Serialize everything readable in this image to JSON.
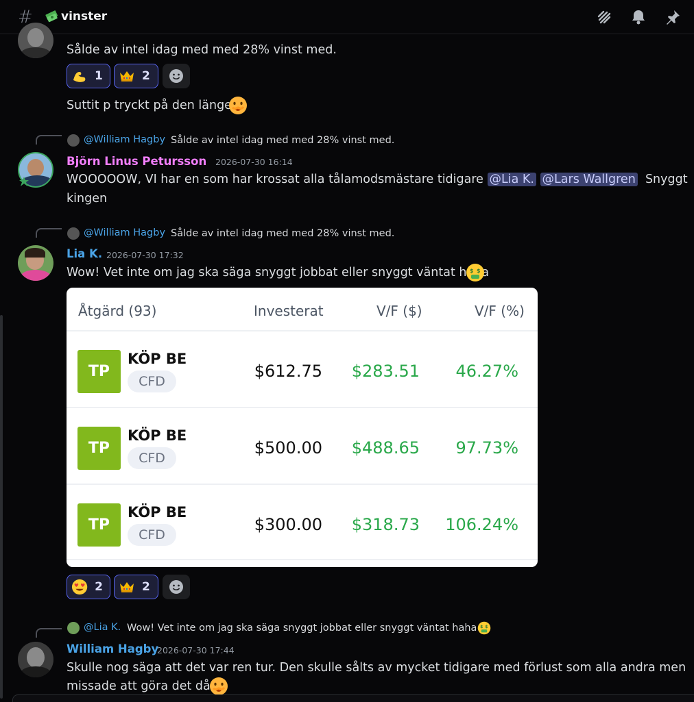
{
  "channel": {
    "name": "vinster",
    "emoji": "money-with-wings"
  },
  "header_icons": [
    "threads-icon",
    "bell-icon",
    "pin-icon"
  ],
  "messages": [
    {
      "text_1": "Sålde av intel idag med med 28% vinst med.",
      "reactions": [
        {
          "emoji": "flexed-biceps",
          "count": "1"
        },
        {
          "emoji": "crown",
          "count": "2"
        }
      ],
      "text_2": "Suttit p tryckt på den länge"
    },
    {
      "reply": {
        "name": "@William Hagby",
        "text": "Sålde av intel idag med med 28% vinst med."
      },
      "author": "Björn Linus Petursson",
      "author_color": "#f47fff",
      "time": "2026-07-30 16:14",
      "text_a": "WOOOOOW, VI har en som har krossat alla tålamodsmästare tidigare",
      "mention_1": "@Lia K.",
      "mention_2": "@Lars Wallgren",
      "text_b": "Snyggt",
      "text_c": "kingen"
    },
    {
      "reply": {
        "name": "@William Hagby",
        "text": "Sålde av intel idag med med 28% vinst med."
      },
      "author": "Lia K.",
      "author_color": "#4aa3e6",
      "time": "2026-07-30 17:32",
      "text": "Wow! Vet inte om jag ska säga snyggt jobbat eller snyggt väntat haha",
      "table": {
        "headers": [
          "Åtgärd (93)",
          "Investerat",
          "V/F ($)",
          "V/F (%)"
        ],
        "rows": [
          {
            "badge": "TP",
            "action": "KÖP BE",
            "type": "CFD",
            "invested": "$612.75",
            "pl": "$283.51",
            "pct": "46.27%"
          },
          {
            "badge": "TP",
            "action": "KÖP BE",
            "type": "CFD",
            "invested": "$500.00",
            "pl": "$488.65",
            "pct": "97.73%"
          },
          {
            "badge": "TP",
            "action": "KÖP BE",
            "type": "CFD",
            "invested": "$300.00",
            "pl": "$318.73",
            "pct": "106.24%"
          }
        ]
      },
      "reactions": [
        {
          "emoji": "heart-eyes",
          "count": "2"
        },
        {
          "emoji": "crown",
          "count": "2"
        }
      ]
    },
    {
      "reply": {
        "name": "@Lia K.",
        "text": "Wow! Vet inte om jag ska säga snyggt jobbat eller snyggt väntat haha"
      },
      "author": "William Hagby",
      "author_color": "#4aa3e6",
      "time": "2026-07-30 17:44",
      "text_1": "Skulle nog säga att det var ren tur. Den skulle sålts av mycket tidigare med förlust som alla andra men",
      "text_2": "missade att göra det då."
    }
  ]
}
